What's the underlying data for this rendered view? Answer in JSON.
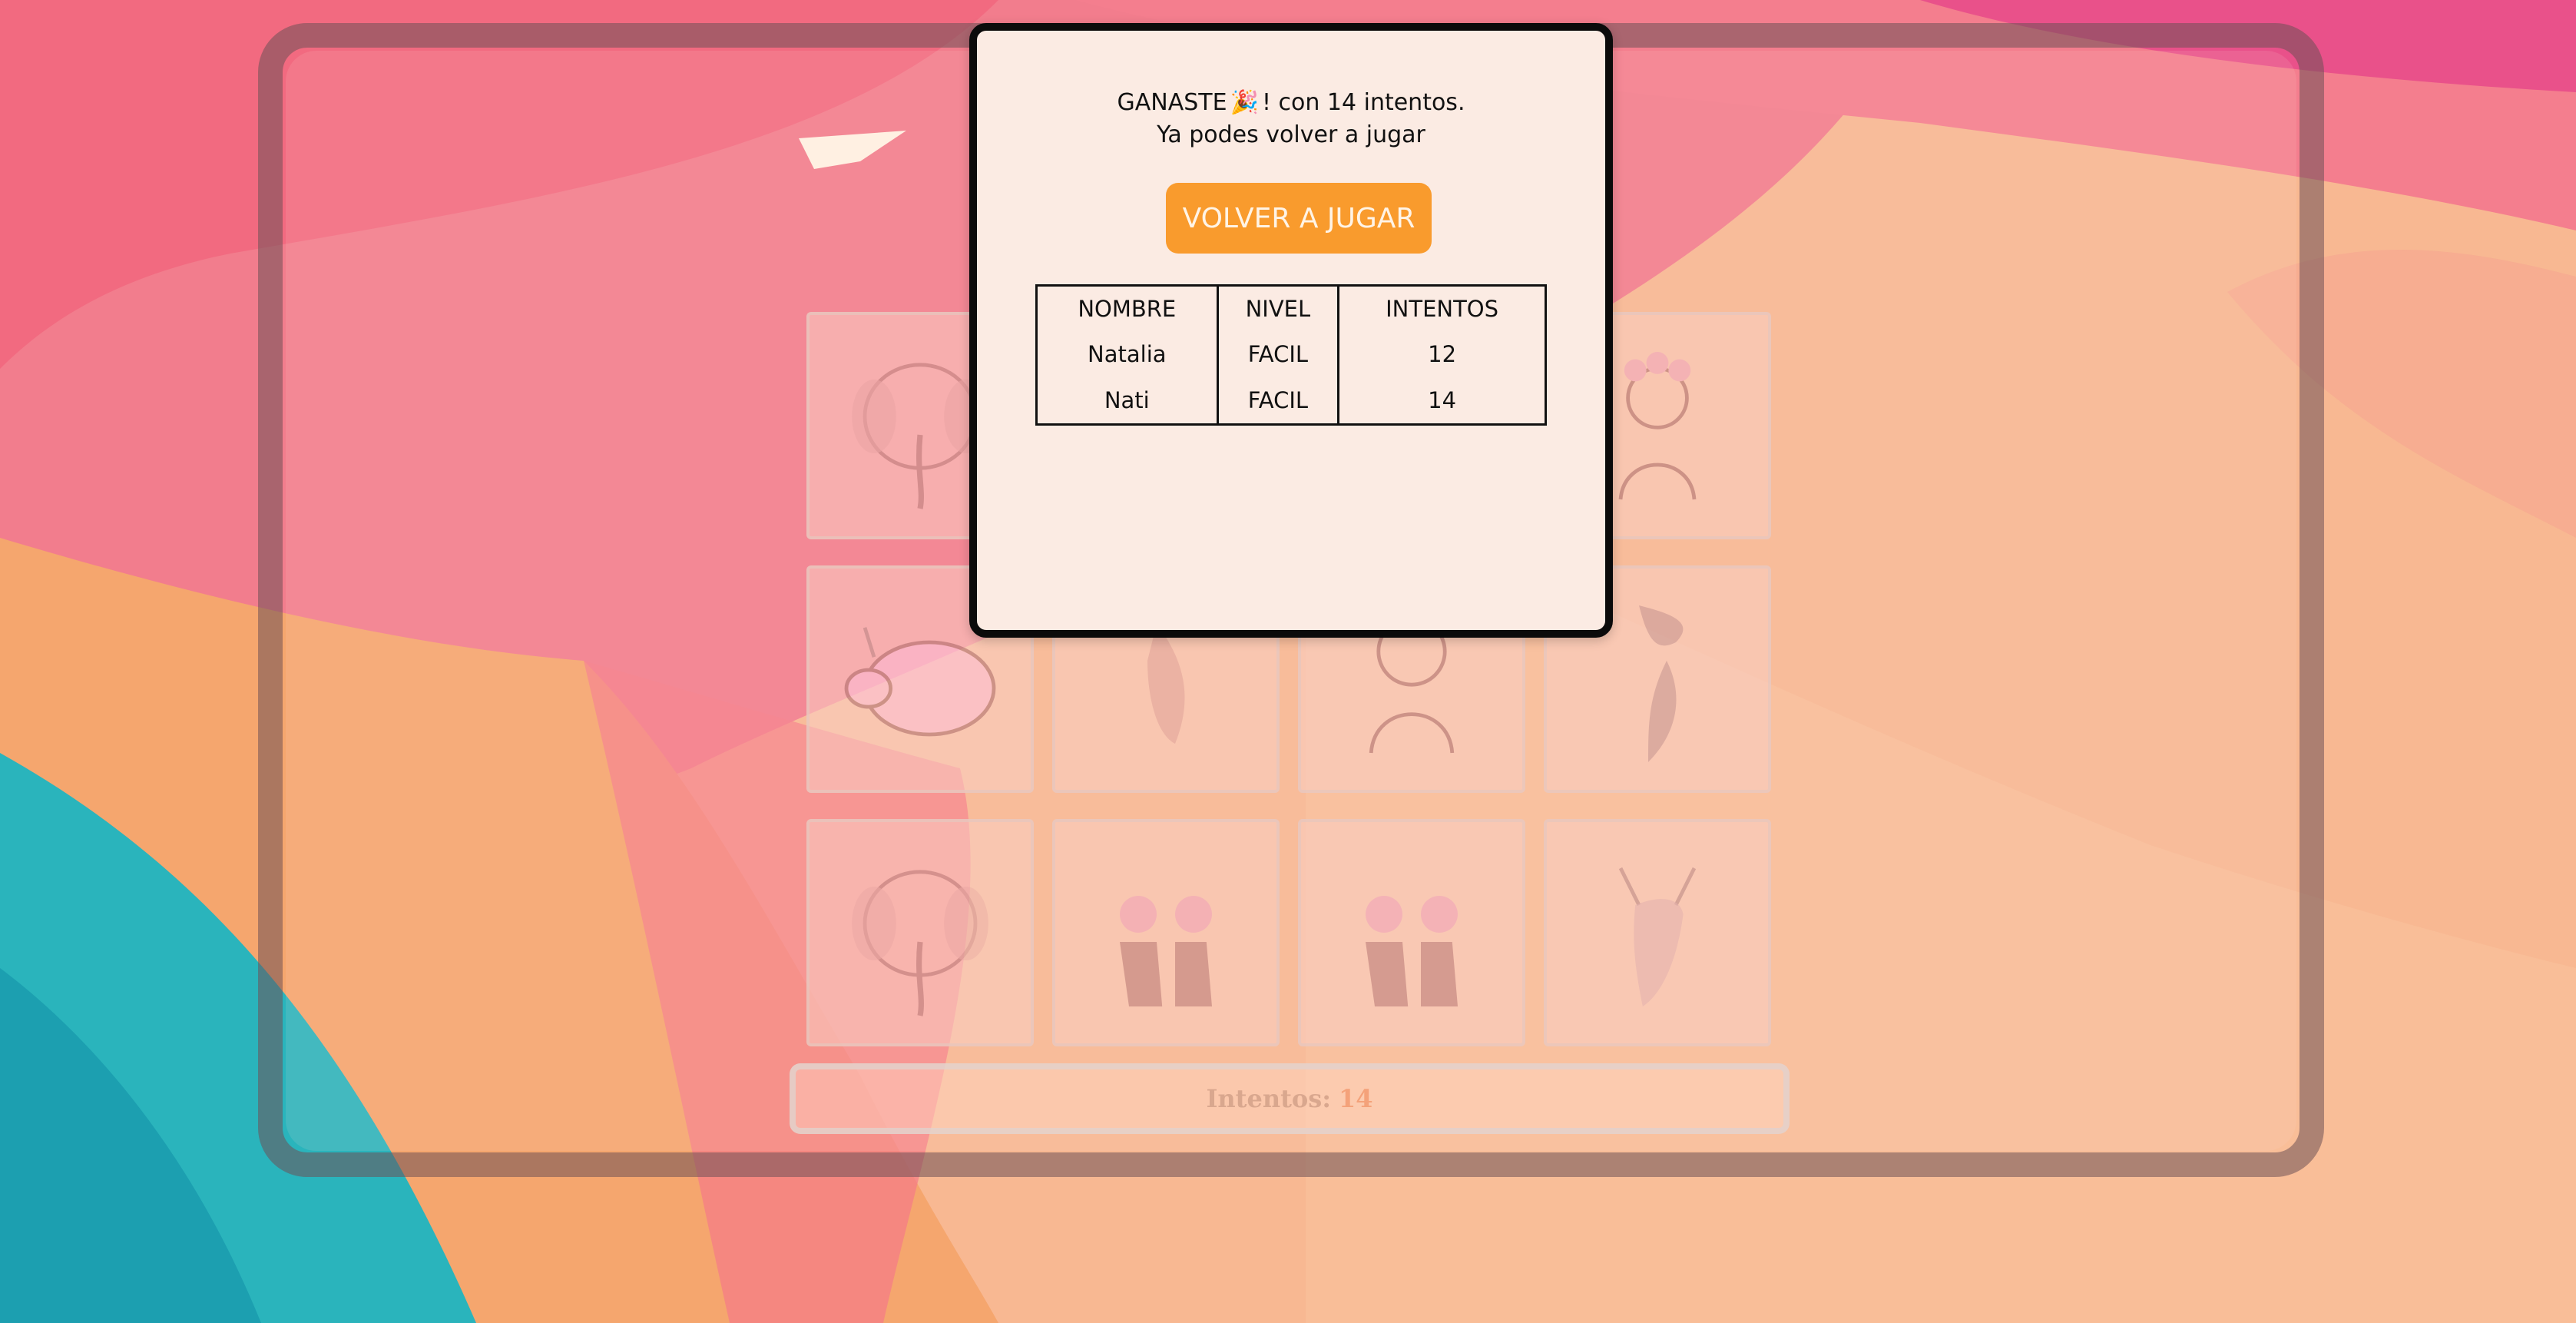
{
  "game": {
    "score_label": "Intentos:",
    "score_value": "14",
    "cards": [
      {
        "icon": "elephant-card-icon"
      },
      {
        "icon": "hidden-card-icon"
      },
      {
        "icon": "hidden-card-icon"
      },
      {
        "icon": "flower-girl-card-icon"
      },
      {
        "icon": "pig-unicorn-card-icon"
      },
      {
        "icon": "deer-card-icon"
      },
      {
        "icon": "girl-card-icon"
      },
      {
        "icon": "fish-card-icon"
      },
      {
        "icon": "elephant-card-icon"
      },
      {
        "icon": "flower-boots-card-icon"
      },
      {
        "icon": "flower-boots-card-icon"
      },
      {
        "icon": "deer-card-icon"
      }
    ]
  },
  "modal": {
    "win_prefix": "GANASTE",
    "win_suffix": "! con 14 intentos.",
    "line2": "Ya podes volver a jugar",
    "button_label": "VOLVER A JUGAR",
    "table": {
      "headers": [
        "NOMBRE",
        "NIVEL",
        "INTENTOS"
      ],
      "rows": [
        [
          "Natalia",
          "FACIL",
          "12"
        ],
        [
          "Nati",
          "FACIL",
          "14"
        ]
      ]
    }
  },
  "colors": {
    "button": "#f99b2d",
    "modal_bg": "#fbebe3",
    "score_number": "#f4a27a"
  }
}
